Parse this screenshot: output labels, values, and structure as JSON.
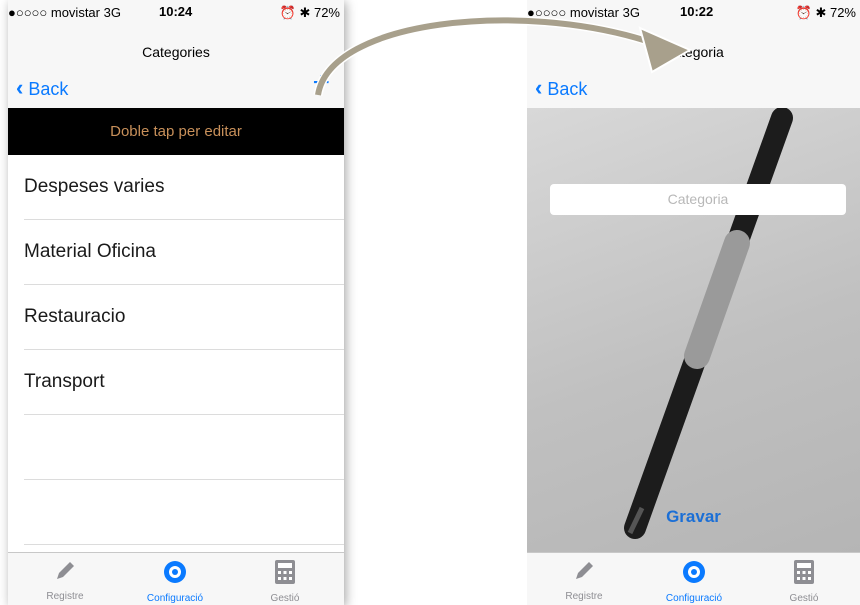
{
  "left": {
    "status": {
      "carrier": "●○○○○ movistar  3G",
      "time": "10:24",
      "battery": "⏰ ✱ 72%"
    },
    "nav": {
      "title": "Categories",
      "back": "Back",
      "add": "+"
    },
    "banner": "Doble tap per editar",
    "rows": [
      "Despeses varies",
      "Material Oficina",
      "Restauracio",
      "Transport"
    ],
    "tabs": [
      "Registre",
      "Configuració",
      "Gestió"
    ]
  },
  "right": {
    "status": {
      "carrier": "●○○○○ movistar  3G",
      "time": "10:22",
      "battery": "⏰ ✱ 72%"
    },
    "nav": {
      "title": "Categoria",
      "back": "Back"
    },
    "input_placeholder": "Categoria",
    "save": "Gravar",
    "tabs": [
      "Registre",
      "Configuració",
      "Gestió"
    ]
  },
  "colors": {
    "accent": "#0a7aff",
    "banner_text": "#c8905a"
  }
}
